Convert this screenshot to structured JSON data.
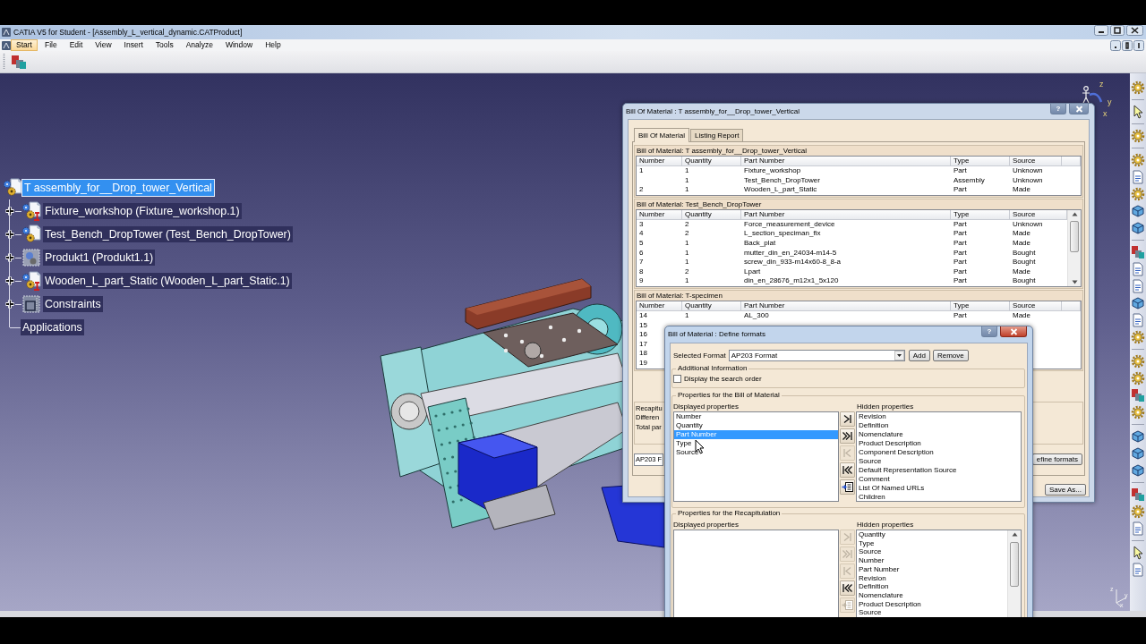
{
  "window": {
    "title": "CATIA V5 for Student - [Assembly_L_vertical_dynamic.CATProduct]"
  },
  "menu": [
    {
      "label": "Start",
      "selected": true
    },
    {
      "label": "File",
      "selected": false
    },
    {
      "label": "Edit",
      "selected": false
    },
    {
      "label": "View",
      "selected": false
    },
    {
      "label": "Insert",
      "selected": false
    },
    {
      "label": "Tools",
      "selected": false
    },
    {
      "label": "Analyze",
      "selected": false
    },
    {
      "label": "Window",
      "selected": false
    },
    {
      "label": "Help",
      "selected": false
    }
  ],
  "tree": {
    "label": "T assembly_for__Drop_tower_Vertical",
    "kind": "assembly",
    "selected": true,
    "children": [
      {
        "label": "Fixture_workshop (Fixture_workshop.1)",
        "kind": "component-link",
        "expanded": false,
        "selected": false
      },
      {
        "label": "Test_Bench_DropTower (Test_Bench_DropTower)",
        "kind": "component",
        "expanded": false,
        "selected": false
      },
      {
        "label": "Produkt1 (Produkt1.1)",
        "kind": "product",
        "expanded": false,
        "selected": false
      },
      {
        "label": "Wooden_L_part_Static (Wooden_L_part_Static.1)",
        "kind": "component-link",
        "expanded": false,
        "selected": false
      },
      {
        "label": "Constraints",
        "kind": "constraints",
        "expanded": false,
        "selected": false
      },
      {
        "label": "Applications",
        "kind": "plain",
        "selected": false
      }
    ]
  },
  "compass": {
    "labels": [
      "z",
      "y",
      "x"
    ]
  },
  "mini_axis": {
    "labels": [
      "z",
      "y",
      "x"
    ]
  },
  "bom_dialog": {
    "title": "Bill Of Material : T assembly_for__Drop_tower_Vertical",
    "help": "?",
    "tabs": [
      {
        "label": "Bill Of Material",
        "selected": true
      },
      {
        "label": "Listing Report",
        "selected": false
      }
    ],
    "sections": [
      {
        "title": "Bill of Material: T assembly_for__Drop_tower_Vertical",
        "columns": [
          "Number",
          "Quantity",
          "Part Number",
          "Type",
          "Source"
        ],
        "scrollbar": false,
        "rows": [
          {
            "number": "1",
            "quantity": "1",
            "part_number": "Fixture_workshop",
            "type": "Part",
            "source": "Unknown"
          },
          {
            "quantity": "1",
            "part_number": "Test_Bench_DropTower",
            "type": "Assembly",
            "source": "Unknown"
          },
          {
            "number": "2",
            "quantity": "1",
            "part_number": "Wooden_L_part_Static",
            "type": "Part",
            "source": "Made"
          }
        ]
      },
      {
        "title": "Bill of Material: Test_Bench_DropTower",
        "columns": [
          "Number",
          "Quantity",
          "Part Number",
          "Type",
          "Source"
        ],
        "scrollbar": true,
        "rows": [
          {
            "number": "3",
            "quantity": "2",
            "part_number": "Force_measurement_device",
            "type": "Part",
            "source": "Unknown"
          },
          {
            "number": "4",
            "quantity": "2",
            "part_number": "L_section_speciman_fix",
            "type": "Part",
            "source": "Made"
          },
          {
            "number": "5",
            "quantity": "1",
            "part_number": "Back_plat",
            "type": "Part",
            "source": "Made"
          },
          {
            "number": "6",
            "quantity": "1",
            "part_number": "mutter_din_en_24034-m14-5",
            "type": "Part",
            "source": "Bought"
          },
          {
            "number": "7",
            "quantity": "1",
            "part_number": "screw_din_933-m14x60-8_8-a",
            "type": "Part",
            "source": "Bought"
          },
          {
            "number": "8",
            "quantity": "2",
            "part_number": "Lpart",
            "type": "Part",
            "source": "Made"
          },
          {
            "number": "9",
            "quantity": "1",
            "part_number": "din_en_28676_m12x1_5x120",
            "type": "Part",
            "source": "Bought"
          }
        ]
      },
      {
        "title": "Bill of Material: T-specimen",
        "columns": [
          "Number",
          "Quantity",
          "Part Number",
          "Type",
          "Source"
        ],
        "scrollbar": false,
        "rows": [
          {
            "number": "14",
            "quantity": "1",
            "part_number": "AL_300",
            "type": "Part",
            "source": "Made"
          },
          {
            "number": "15"
          },
          {
            "number": "16"
          },
          {
            "number": "17"
          },
          {
            "number": "18"
          },
          {
            "number": "19"
          }
        ]
      }
    ],
    "recapitulation": [
      "Recapitu",
      "Differen",
      "Total par"
    ],
    "format_field": "AP203 F",
    "define_formats_button": "efine formats",
    "save_button": "Save As..."
  },
  "formats_dialog": {
    "title": "Bill of Material : Define formats",
    "help": "?",
    "selected_format_label": "Selected Format",
    "selected_format": "AP203 Format",
    "add_button": "Add",
    "remove_button": "Remove",
    "additional_info": {
      "title": "Additional Information",
      "checkbox_label": "Display the search order",
      "checked": false
    },
    "bom_properties": {
      "title": "Properties for the Bill of Material",
      "displayed_label": "Displayed properties",
      "hidden_label": "Hidden properties",
      "scrollbar": false,
      "displayed": [
        {
          "label": "Number",
          "selected": false
        },
        {
          "label": "Quantity",
          "selected": false
        },
        {
          "label": "Part Number",
          "selected": true
        },
        {
          "label": "Type",
          "selected": false
        },
        {
          "label": "Source",
          "selected": false
        }
      ],
      "hidden": [
        {
          "label": "Revision",
          "selected": false
        },
        {
          "label": "Definition",
          "selected": false
        },
        {
          "label": "Nomenclature",
          "selected": false
        },
        {
          "label": "Product Description",
          "selected": false
        },
        {
          "label": "Component Description",
          "selected": false
        },
        {
          "label": "Source",
          "selected": false
        },
        {
          "label": "Default Representation Source",
          "selected": false
        },
        {
          "label": "Comment",
          "selected": false
        },
        {
          "label": "List Of Named URLs",
          "selected": false
        },
        {
          "label": "Children",
          "selected": false
        }
      ],
      "move_buttons": [
        {
          "kind": "add",
          "disabled": false
        },
        {
          "kind": "add-all",
          "disabled": false
        },
        {
          "kind": "remove",
          "disabled": true
        },
        {
          "kind": "remove-all",
          "disabled": false
        },
        {
          "kind": "order",
          "disabled": false
        }
      ]
    },
    "recap_properties": {
      "title": "Properties for the Recapitulation",
      "displayed_label": "Displayed properties",
      "hidden_label": "Hidden properties",
      "scrollbar": true,
      "hidden": [
        {
          "label": "Quantity",
          "selected": false
        },
        {
          "label": "Type",
          "selected": false
        },
        {
          "label": "Source",
          "selected": false
        },
        {
          "label": "Number",
          "selected": false
        },
        {
          "label": "Part Number",
          "selected": false
        },
        {
          "label": "Revision",
          "selected": false
        },
        {
          "label": "Definition",
          "selected": false
        },
        {
          "label": "Nomenclature",
          "selected": false
        },
        {
          "label": "Product Description",
          "selected": false
        },
        {
          "label": "Source",
          "selected": false
        }
      ],
      "move_buttons": [
        {
          "kind": "add",
          "disabled": true
        },
        {
          "kind": "add-all",
          "disabled": true
        },
        {
          "kind": "remove",
          "disabled": true
        },
        {
          "kind": "remove-all",
          "disabled": false
        },
        {
          "kind": "order",
          "disabled": true
        }
      ]
    }
  }
}
